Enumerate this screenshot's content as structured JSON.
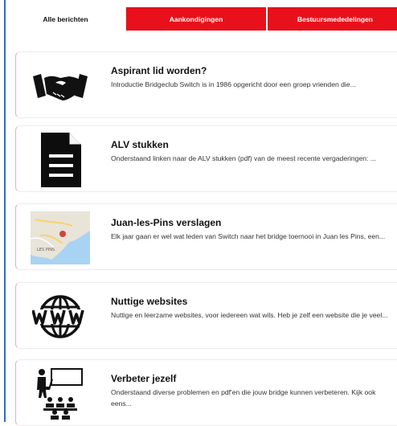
{
  "tabs": [
    {
      "label": "Alle berichten",
      "active": true
    },
    {
      "label": "Aankondigingen",
      "active": false
    },
    {
      "label": "Bestuursmededelingen",
      "active": false
    }
  ],
  "colors": {
    "accent": "#e8111b",
    "window_border": "#2f6db5"
  },
  "posts": [
    {
      "icon": "handshake-icon",
      "title": "Aspirant lid worden?",
      "excerpt": "Introductie Bridgeclub Switch is in 1986 opgericht door een groep vrienden die..."
    },
    {
      "icon": "document-icon",
      "title": "ALV stukken",
      "excerpt": "Onderstaand linken naar de ALV stukken (pdf) van de meest recente vergaderingen: ..."
    },
    {
      "icon": "map-thumbnail",
      "title": "Juan-les-Pins verslagen",
      "excerpt": "Elk jaar gaan er wel wat leden van Switch naar het bridge toernooi in Juan les Pins, een...",
      "map_labels": [
        "LES PINS"
      ]
    },
    {
      "icon": "www-icon",
      "title": "Nuttige websites",
      "excerpt": "Nuttige en leerzame websites, voor iedereen wat wils. Heb je zelf een website die je veel..."
    },
    {
      "icon": "classroom-icon",
      "title": "Verbeter jezelf",
      "excerpt": "Onderstaand diverse problemen en pdf'en die jouw bridge kunnen verbeteren. Kijk ook eens..."
    }
  ]
}
